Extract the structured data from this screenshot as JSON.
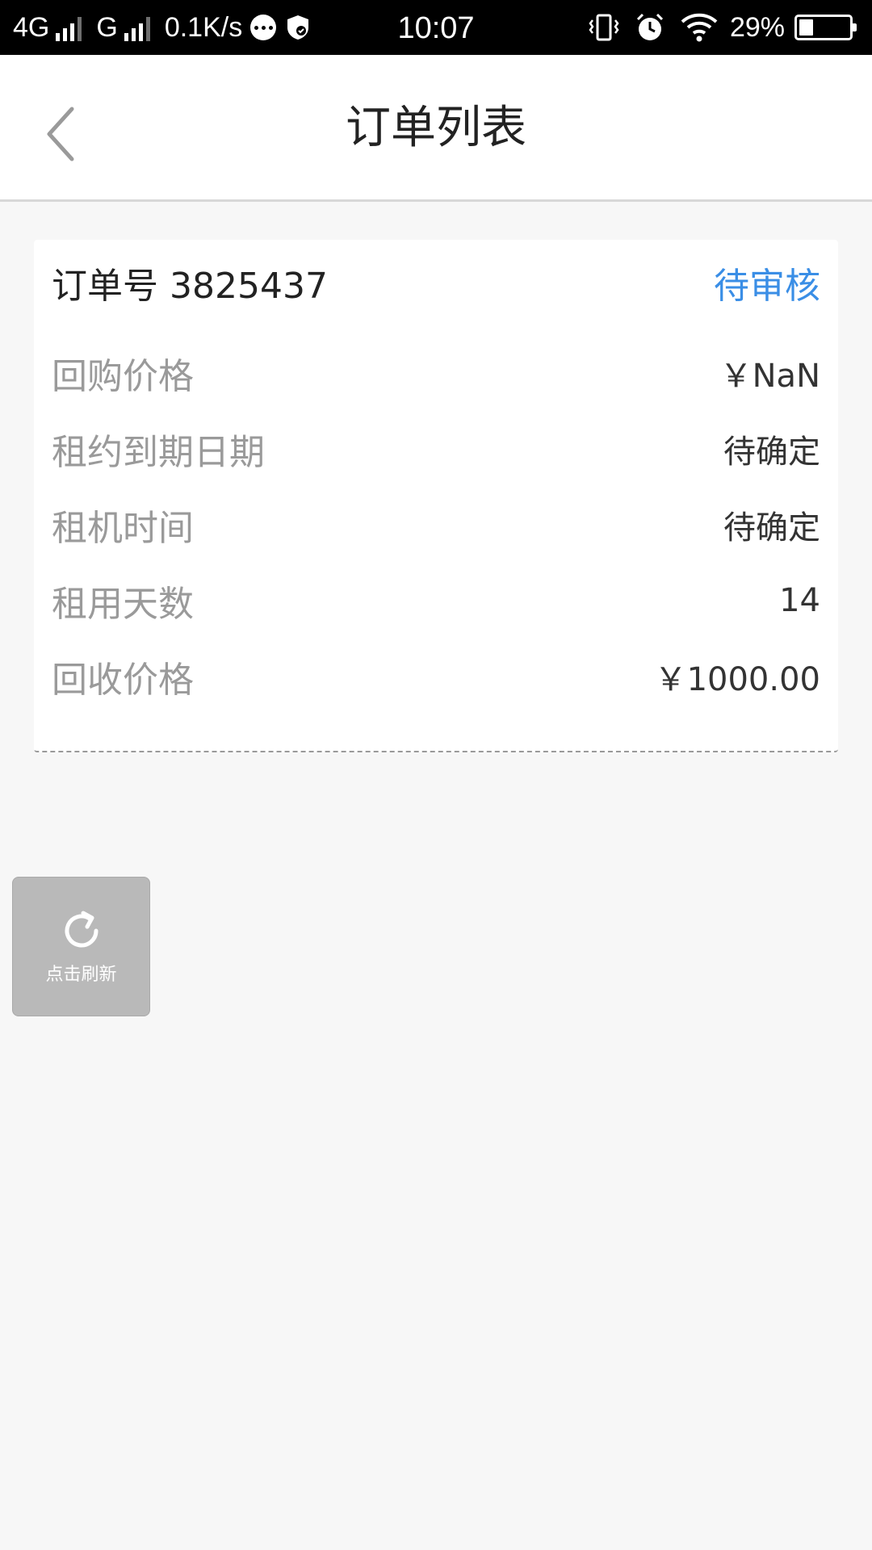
{
  "status_bar": {
    "network_1": "4G",
    "network_2": "G",
    "speed": "0.1K/s",
    "time": "10:07",
    "battery": "29%",
    "battery_level": 0.29,
    "icons": [
      "signal-icon",
      "chat-icon",
      "shield-icon",
      "vibrate-icon",
      "alarm-icon",
      "wifi-icon",
      "battery-icon"
    ]
  },
  "nav": {
    "title": "订单列表",
    "back_icon": "chevron-left-icon"
  },
  "order": {
    "number": "订单号 3825437",
    "status": "待审核",
    "status_color": "#3a8ee6",
    "rows": [
      {
        "label": "回购价格",
        "value": "￥NaN"
      },
      {
        "label": "租约到期日期",
        "value": "待确定"
      },
      {
        "label": "租机时间",
        "value": "待确定"
      },
      {
        "label": "租用天数",
        "value": "14"
      },
      {
        "label": "回收价格",
        "value": "￥1000.00"
      }
    ]
  },
  "refresh": {
    "label": "点击刷新",
    "icon": "refresh-icon"
  }
}
